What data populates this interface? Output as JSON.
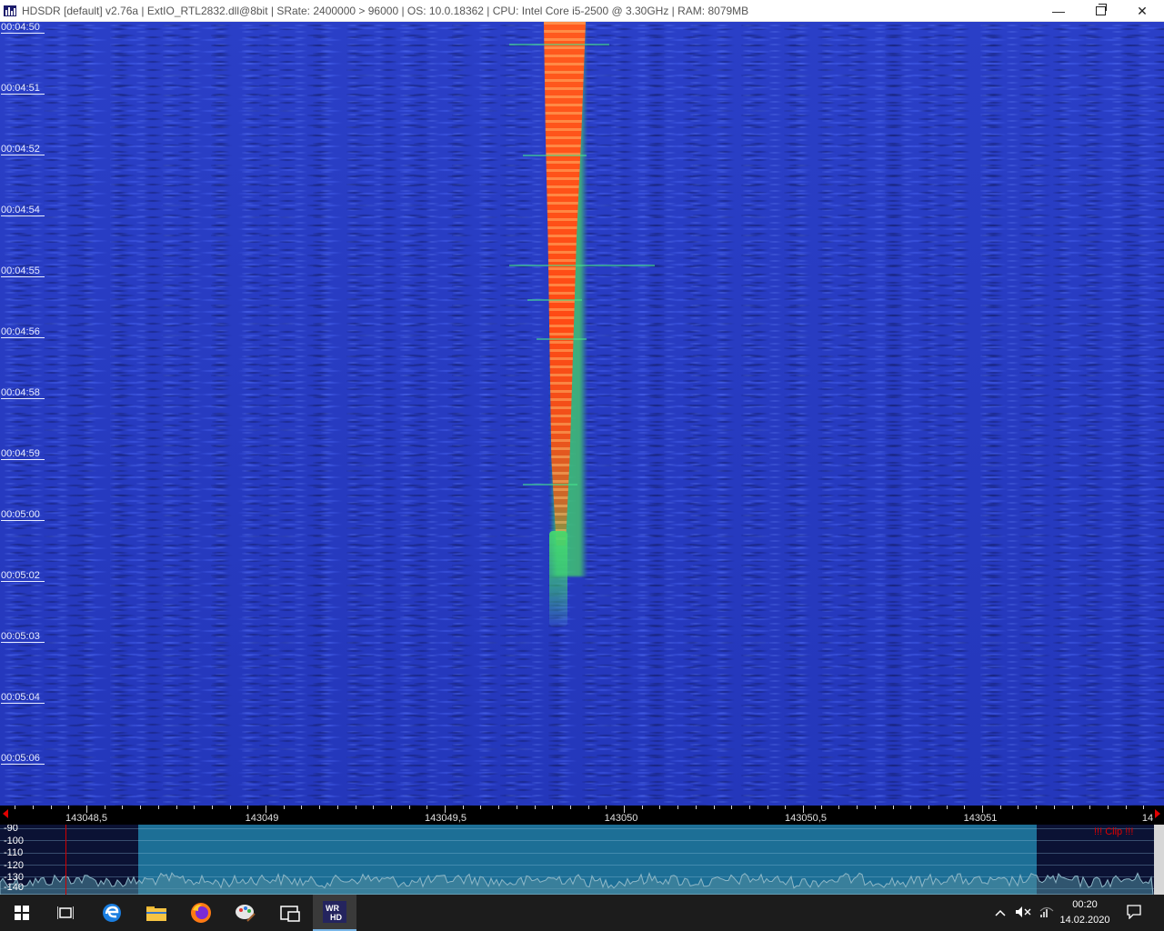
{
  "window": {
    "title": "HDSDR  [default]  v2.76a  |  ExtIO_RTL2832.dll@8bit  |  SRate: 2400000 > 96000  |  OS: 10.0.18362   |  CPU: Intel Core i5-2500 @ 3.30GHz  |  RAM: 8079MB",
    "minimize_label": "—",
    "close_label": "✕"
  },
  "waterfall": {
    "time_labels": [
      "00:04:50",
      "00:04:51",
      "00:04:52",
      "00:04:54",
      "00:04:55",
      "00:04:56",
      "00:04:58",
      "00:04:59",
      "00:05:00",
      "00:05:02",
      "00:05:03",
      "00:05:04",
      "00:05:06"
    ]
  },
  "frequency_scale": {
    "labels": [
      "143048,5",
      "143049",
      "143049,5",
      "143050",
      "143050,5",
      "143051",
      "14"
    ]
  },
  "spectrum": {
    "db_labels": [
      "-90",
      "-100",
      "-110",
      "-120",
      "-130",
      "-140"
    ],
    "clip_label": "!!! Clip !!!"
  },
  "taskbar": {
    "icons": [
      "windows-start-icon",
      "task-view-icon",
      "edge-icon",
      "file-explorer-icon",
      "firefox-icon",
      "paint-icon",
      "app-icon",
      "hdsdr-icon"
    ],
    "clock_time": "00:20",
    "clock_date": "14.02.2020"
  },
  "colors": {
    "waterfall_bg": "#2437bb",
    "signal": "#ff4a14",
    "spectrum_band": "#1d6f96",
    "marker": "#d00000"
  }
}
